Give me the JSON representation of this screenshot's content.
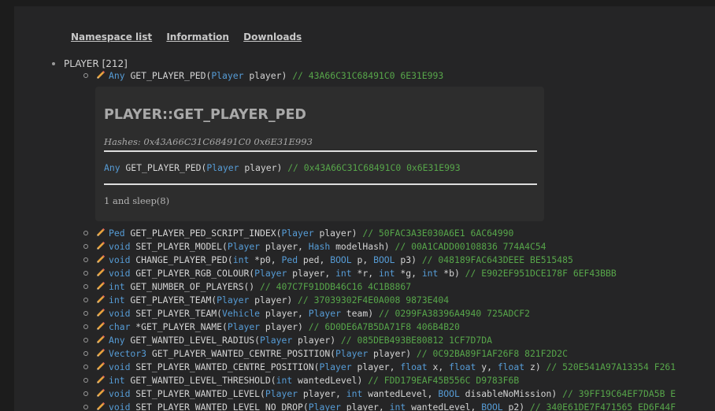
{
  "nav": {
    "items": [
      "Namespace list",
      "Information",
      "Downloads"
    ]
  },
  "category": {
    "name": "PLAYER",
    "count": "[212]"
  },
  "first_native": {
    "ret": "Any",
    "name": "GET_PLAYER_PED",
    "open": "(",
    "p1type": "Player",
    "p1": " player",
    "close": ")",
    "hash": "// 43A66C31C68491C0 6E31E993"
  },
  "panel": {
    "title": "PLAYER::GET_PLAYER_PED",
    "hashes": "Hashes: 0x43A66C31C68491C0 0x6E31E993",
    "sig_ret": "Any",
    "sig_name": " GET_PLAYER_PED(",
    "sig_ptype": "Player",
    "sig_rest": " player)",
    "sig_hash": " // 0x43A66C31C68491C0 0x6E31E993",
    "description": "1 and sleep(8)"
  },
  "natives": [
    [
      [
        "t",
        "Ped"
      ],
      [
        "n",
        " GET_PLAYER_PED_SCRIPT_INDEX("
      ],
      [
        "t",
        "Player"
      ],
      [
        "n",
        " player)"
      ],
      [
        "c",
        " // 50FAC3A3E030A6E1 6AC64990"
      ]
    ],
    [
      [
        "t",
        "void"
      ],
      [
        "n",
        " SET_PLAYER_MODEL("
      ],
      [
        "t",
        "Player"
      ],
      [
        "n",
        " player, "
      ],
      [
        "t",
        "Hash"
      ],
      [
        "n",
        " modelHash)"
      ],
      [
        "c",
        " // 00A1CADD00108836 774A4C54"
      ]
    ],
    [
      [
        "t",
        "void"
      ],
      [
        "n",
        " CHANGE_PLAYER_PED("
      ],
      [
        "t",
        "int"
      ],
      [
        "n",
        " *p0, "
      ],
      [
        "t",
        "Ped"
      ],
      [
        "n",
        " ped, "
      ],
      [
        "t",
        "BOOL"
      ],
      [
        "n",
        " p, "
      ],
      [
        "t",
        "BOOL"
      ],
      [
        "n",
        " p3)"
      ],
      [
        "c",
        " // 048189FAC643DEEE BE515485"
      ]
    ],
    [
      [
        "t",
        "void"
      ],
      [
        "n",
        " GET_PLAYER_RGB_COLOUR("
      ],
      [
        "t",
        "Player"
      ],
      [
        "n",
        " player, "
      ],
      [
        "t",
        "int"
      ],
      [
        "n",
        " *r, "
      ],
      [
        "t",
        "int"
      ],
      [
        "n",
        " *g, "
      ],
      [
        "t",
        "int"
      ],
      [
        "n",
        " *b)"
      ],
      [
        "c",
        " // E902EF951DCE178F 6EF43BBB"
      ]
    ],
    [
      [
        "t",
        "int"
      ],
      [
        "n",
        " GET_NUMBER_OF_PLAYERS()"
      ],
      [
        "c",
        " // 407C7F91DDB46C16 4C1B8867"
      ]
    ],
    [
      [
        "t",
        "int"
      ],
      [
        "n",
        " GET_PLAYER_TEAM("
      ],
      [
        "t",
        "Player"
      ],
      [
        "n",
        " player)"
      ],
      [
        "c",
        " // 37039302F4E0A008 9873E404"
      ]
    ],
    [
      [
        "t",
        "void"
      ],
      [
        "n",
        " SET_PLAYER_TEAM("
      ],
      [
        "t",
        "Vehicle"
      ],
      [
        "n",
        " player, "
      ],
      [
        "t",
        "Player"
      ],
      [
        "n",
        " team)"
      ],
      [
        "c",
        " // 0299FA38396A4940 725ADCF2"
      ]
    ],
    [
      [
        "t",
        "char"
      ],
      [
        "n",
        " *GET_PLAYER_NAME("
      ],
      [
        "t",
        "Player"
      ],
      [
        "n",
        " player)"
      ],
      [
        "c",
        " // 6D0DE6A7B5DA71F8 406B4B20"
      ]
    ],
    [
      [
        "t",
        "Any"
      ],
      [
        "n",
        " GET_WANTED_LEVEL_RADIUS("
      ],
      [
        "t",
        "Player"
      ],
      [
        "n",
        " player)"
      ],
      [
        "c",
        " // 085DEB493BE80812 1CF7D7DA"
      ]
    ],
    [
      [
        "t",
        "Vector3"
      ],
      [
        "n",
        " GET_PLAYER_WANTED_CENTRE_POSITION("
      ],
      [
        "t",
        "Player"
      ],
      [
        "n",
        " player)"
      ],
      [
        "c",
        " // 0C92BA89F1AF26F8 821F2D2C"
      ]
    ],
    [
      [
        "t",
        "void"
      ],
      [
        "n",
        " SET_PLAYER_WANTED_CENTRE_POSITION("
      ],
      [
        "t",
        "Player"
      ],
      [
        "n",
        " player, "
      ],
      [
        "t",
        "float"
      ],
      [
        "n",
        " x, "
      ],
      [
        "t",
        "float"
      ],
      [
        "n",
        " y, "
      ],
      [
        "t",
        "float"
      ],
      [
        "n",
        " z)"
      ],
      [
        "c",
        " // 520E541A97A13354 F261"
      ]
    ],
    [
      [
        "t",
        "int"
      ],
      [
        "n",
        " GET_WANTED_LEVEL_THRESHOLD("
      ],
      [
        "t",
        "int"
      ],
      [
        "n",
        " wantedLevel)"
      ],
      [
        "c",
        " // FDD179EAF45B556C D9783F6B"
      ]
    ],
    [
      [
        "t",
        "void"
      ],
      [
        "n",
        " SET_PLAYER_WANTED_LEVEL("
      ],
      [
        "t",
        "Player"
      ],
      [
        "n",
        " player, "
      ],
      [
        "t",
        "int"
      ],
      [
        "n",
        " wantedLevel, "
      ],
      [
        "t",
        "BOOL"
      ],
      [
        "n",
        " disableNoMission)"
      ],
      [
        "c",
        " // 39FF19C64EF7DA5B E"
      ]
    ],
    [
      [
        "t",
        "void"
      ],
      [
        "n",
        " SET_PLAYER_WANTED_LEVEL_NO_DROP("
      ],
      [
        "t",
        "Player"
      ],
      [
        "n",
        " player, "
      ],
      [
        "t",
        "int"
      ],
      [
        "n",
        " wantedLevel, "
      ],
      [
        "t",
        "BOOL"
      ],
      [
        "n",
        " p2)"
      ],
      [
        "c",
        " // 340E61DE7F471565 ED6F44F"
      ]
    ]
  ],
  "colors": {
    "type": "#569cd6",
    "comment": "#57a64a",
    "text": "#d4d4d4",
    "background": "#252526"
  }
}
